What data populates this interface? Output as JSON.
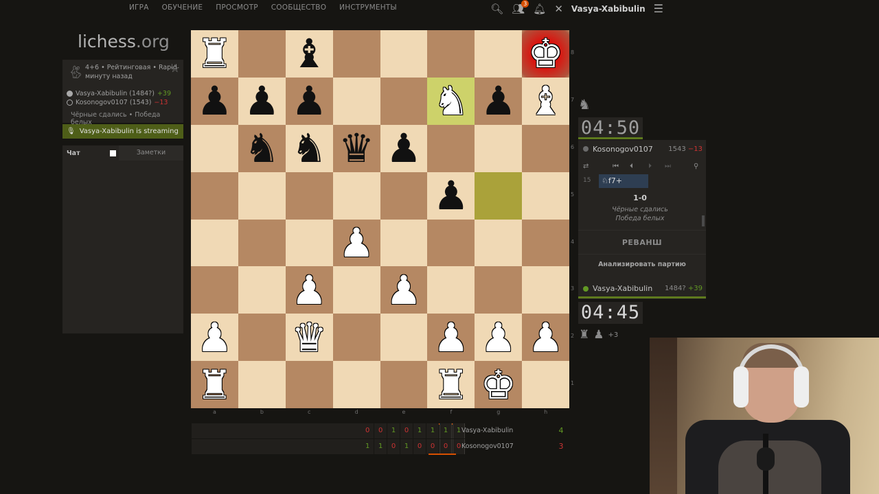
{
  "topnav": {
    "menu": [
      "ИГРА",
      "ОБУЧЕНИЕ",
      "ПРОСМОТР",
      "СООБЩЕСТВО",
      "ИНСТРУМЕНТЫ"
    ],
    "notification_count": "3",
    "username": "Vasya-Xabibulin"
  },
  "logo": {
    "main": "lichess",
    "suffix": ".org"
  },
  "game_info": {
    "line1": "4+6 • Рейтинговая • Rapid",
    "line2": "минуту назад",
    "white_player": "Vasya-Xabibulin (1484?)",
    "white_diff": "+39",
    "black_player": "Kosonogov0107 (1543)",
    "black_diff": "−13",
    "result": "Чёрные сдались • Победа белых"
  },
  "streaming": {
    "text": "Vasya-Xabibulin is streaming"
  },
  "chat": {
    "tab_chat": "Чат",
    "tab_notes": "Заметки"
  },
  "board": {
    "ranks": [
      "8",
      "7",
      "6",
      "5",
      "4",
      "3",
      "2",
      "1"
    ],
    "files": [
      "a",
      "b",
      "c",
      "d",
      "e",
      "f",
      "g",
      "h"
    ],
    "squares": [
      [
        {
          "p": "♜",
          "c": "w"
        },
        {
          "p": "",
          "c": ""
        },
        {
          "p": "♝",
          "c": "b"
        },
        {
          "p": "",
          "c": ""
        },
        {
          "p": "",
          "c": ""
        },
        {
          "p": "",
          "c": ""
        },
        {
          "p": "",
          "c": ""
        },
        {
          "p": "♚",
          "c": "w",
          "check": true
        }
      ],
      [
        {
          "p": "♟",
          "c": "b"
        },
        {
          "p": "♟",
          "c": "b"
        },
        {
          "p": "♟",
          "c": "b"
        },
        {
          "p": "",
          "c": ""
        },
        {
          "p": "",
          "c": ""
        },
        {
          "p": "♞",
          "c": "w",
          "hl": true
        },
        {
          "p": "♟",
          "c": "b"
        },
        {
          "p": "♝",
          "c": "w"
        }
      ],
      [
        {
          "p": "",
          "c": ""
        },
        {
          "p": "♞",
          "c": "b"
        },
        {
          "p": "♞",
          "c": "b"
        },
        {
          "p": "♛",
          "c": "b"
        },
        {
          "p": "♟",
          "c": "b"
        },
        {
          "p": "",
          "c": ""
        },
        {
          "p": "",
          "c": ""
        },
        {
          "p": "",
          "c": ""
        }
      ],
      [
        {
          "p": "",
          "c": ""
        },
        {
          "p": "",
          "c": ""
        },
        {
          "p": "",
          "c": ""
        },
        {
          "p": "",
          "c": ""
        },
        {
          "p": "",
          "c": ""
        },
        {
          "p": "♟",
          "c": "b"
        },
        {
          "p": "",
          "c": "",
          "hl": true
        },
        {
          "p": "",
          "c": ""
        }
      ],
      [
        {
          "p": "",
          "c": ""
        },
        {
          "p": "",
          "c": ""
        },
        {
          "p": "",
          "c": ""
        },
        {
          "p": "♟",
          "c": "w"
        },
        {
          "p": "",
          "c": ""
        },
        {
          "p": "",
          "c": ""
        },
        {
          "p": "",
          "c": ""
        },
        {
          "p": "",
          "c": ""
        }
      ],
      [
        {
          "p": "",
          "c": ""
        },
        {
          "p": "",
          "c": ""
        },
        {
          "p": "♟",
          "c": "w"
        },
        {
          "p": "",
          "c": ""
        },
        {
          "p": "♟",
          "c": "w"
        },
        {
          "p": "",
          "c": ""
        },
        {
          "p": "",
          "c": ""
        },
        {
          "p": "",
          "c": ""
        }
      ],
      [
        {
          "p": "♟",
          "c": "w"
        },
        {
          "p": "",
          "c": ""
        },
        {
          "p": "♛",
          "c": "w"
        },
        {
          "p": "",
          "c": ""
        },
        {
          "p": "",
          "c": ""
        },
        {
          "p": "♟",
          "c": "w"
        },
        {
          "p": "♟",
          "c": "w"
        },
        {
          "p": "♟",
          "c": "w"
        }
      ],
      [
        {
          "p": "♜",
          "c": "w"
        },
        {
          "p": "",
          "c": ""
        },
        {
          "p": "",
          "c": ""
        },
        {
          "p": "",
          "c": ""
        },
        {
          "p": "",
          "c": ""
        },
        {
          "p": "♜",
          "c": "w"
        },
        {
          "p": "♚",
          "c": "w"
        },
        {
          "p": "",
          "c": ""
        }
      ]
    ]
  },
  "crosstable": {
    "white": {
      "name": "Vasya-Xabibulin",
      "score": "4",
      "results": [
        "0",
        "0",
        "1",
        "0",
        "1",
        "1",
        "1",
        "1"
      ]
    },
    "black": {
      "name": "Kosonogov0107",
      "score": "3",
      "results": [
        "1",
        "1",
        "0",
        "1",
        "0",
        "0",
        "0",
        "0"
      ]
    }
  },
  "clocks": {
    "top": "04:50",
    "bottom": "04:45"
  },
  "right_panel": {
    "top_player": {
      "name": "Kosonogov0107",
      "rating": "1543",
      "diff": "−13"
    },
    "bottom_player": {
      "name": "Vasya-Xabibulin",
      "rating": "1484?",
      "diff": "+39"
    },
    "move_number": "15",
    "last_move": "♘f7+",
    "result_score": "1-0",
    "result_text1": "Чёрные сдались",
    "result_text2": "Победа белых",
    "rematch": "РЕВАНШ",
    "analyse": "Анализировать партию",
    "captured_plus": "+3"
  }
}
